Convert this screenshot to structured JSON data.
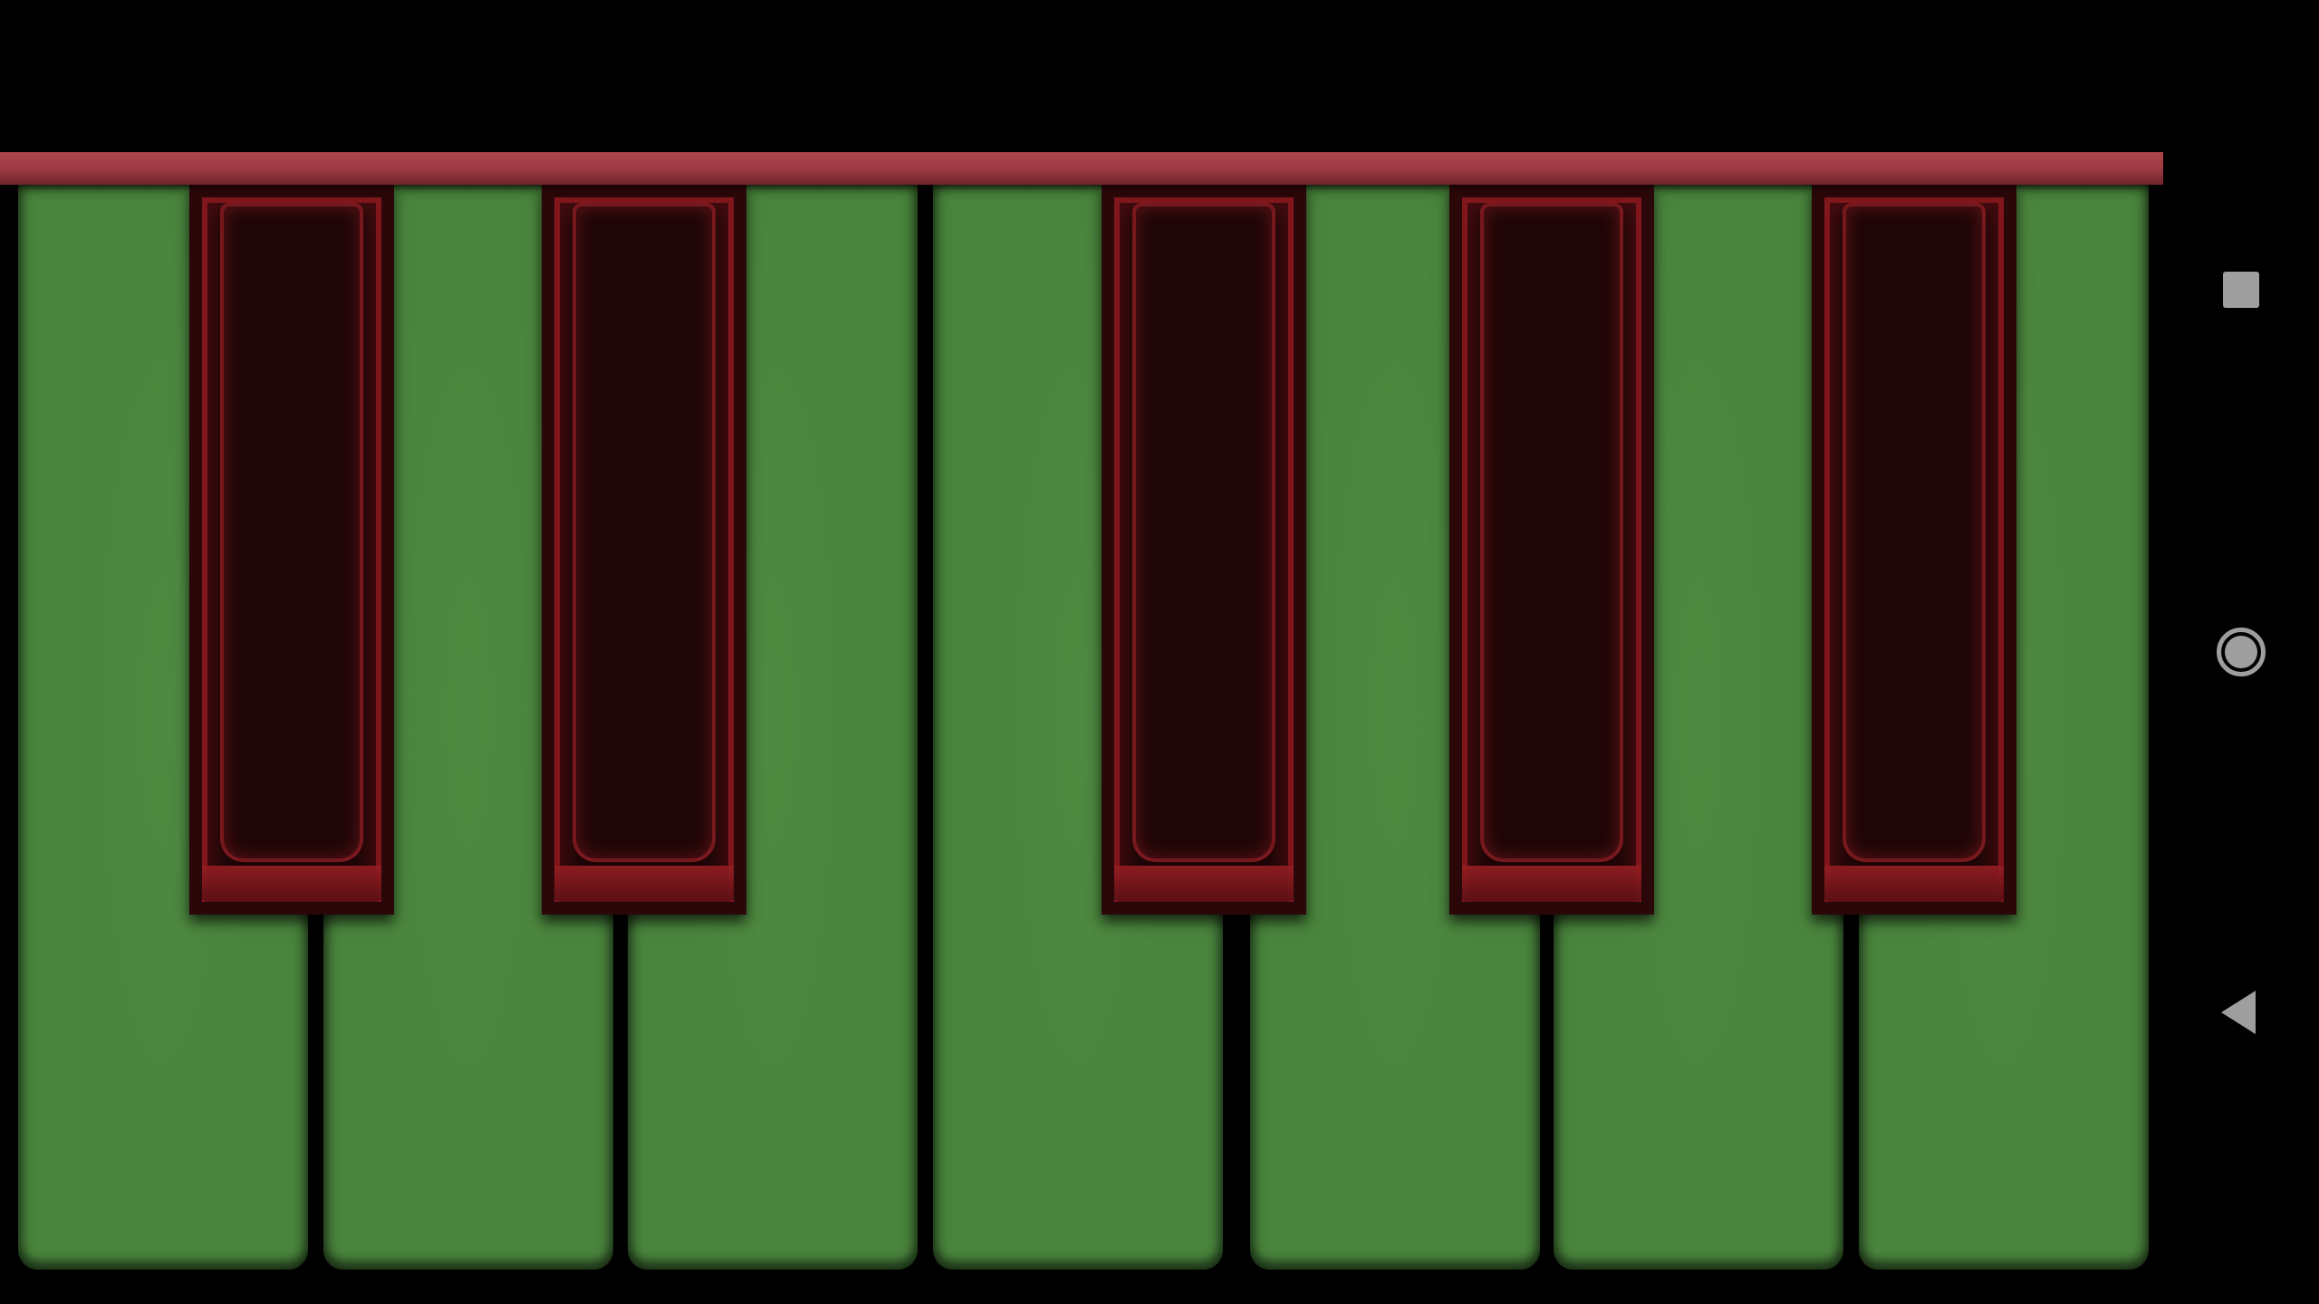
{
  "app": {
    "name": "piano-keyboard"
  },
  "colors": {
    "background": "#000000",
    "rail": "#9a3a42",
    "white_key": "#4a853d",
    "black_key": "#1c0506",
    "black_key_trim": "#8c191e",
    "nav_icon": "#9e9e9e"
  },
  "keyboard": {
    "white_key_count": 7,
    "black_key_count": 5,
    "white_keys": [
      "white-key-1",
      "white-key-2",
      "white-key-3",
      "white-key-4",
      "white-key-5",
      "white-key-6",
      "white-key-7"
    ],
    "black_keys": [
      "black-key-1",
      "black-key-2",
      "black-key-3",
      "black-key-4",
      "black-key-5"
    ]
  },
  "navbar": {
    "buttons": [
      {
        "name": "recents-button",
        "icon": "square-icon"
      },
      {
        "name": "home-button",
        "icon": "circle-icon"
      },
      {
        "name": "back-button",
        "icon": "triangle-back-icon"
      }
    ]
  }
}
